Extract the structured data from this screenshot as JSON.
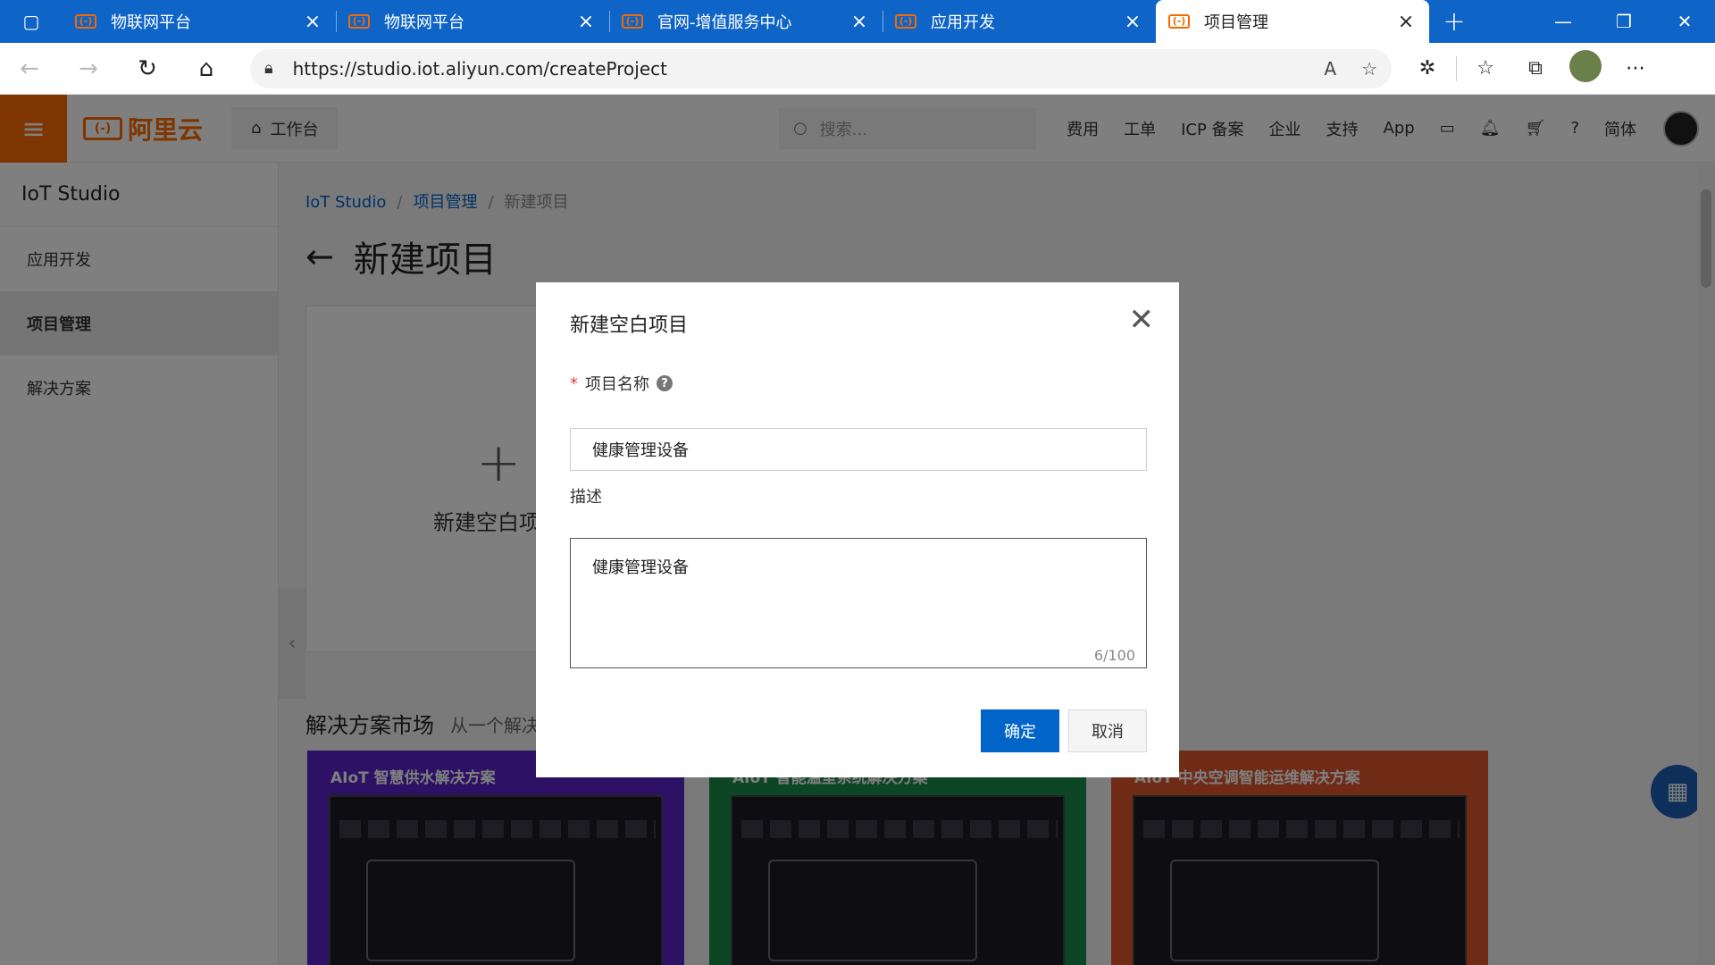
{
  "browser": {
    "tabs": [
      {
        "title": "物联网平台",
        "active": false
      },
      {
        "title": "物联网平台",
        "active": false
      },
      {
        "title": "官网-增值服务中心",
        "active": false
      },
      {
        "title": "应用开发",
        "active": false
      },
      {
        "title": "项目管理",
        "active": true
      }
    ],
    "favicon_glyph": "(-)",
    "url": "https://studio.iot.aliyun.com/createProject"
  },
  "topnav": {
    "brand": "阿里云",
    "workbench": "工作台",
    "search_placeholder": "搜索...",
    "links": [
      "费用",
      "工单",
      "ICP 备案",
      "企业",
      "支持",
      "App"
    ],
    "language": "简体"
  },
  "sidebar": {
    "title": "IoT Studio",
    "items": [
      {
        "label": "应用开发",
        "active": false
      },
      {
        "label": "项目管理",
        "active": true
      },
      {
        "label": "解决方案",
        "active": false
      }
    ]
  },
  "main": {
    "breadcrumb": [
      "IoT Studio",
      "项目管理",
      "新建项目"
    ],
    "page_title": "新建项目",
    "blank_card_label": "新建空白项",
    "market_title": "解决方案市场",
    "market_subtitle": "从一个解决",
    "solutions": [
      {
        "title": "AIoT 智慧供水解决方案",
        "color": "#5b23c9"
      },
      {
        "title": "AIoT 智能温室系统解决方案",
        "color": "#1a8c4a"
      },
      {
        "title": "AIoT 中央空调智能运维解决方案",
        "color": "#e0572c"
      }
    ]
  },
  "modal": {
    "title": "新建空白项目",
    "name_label": "项目名称",
    "name_required_mark": "*",
    "name_value": "健康管理设备",
    "desc_label": "描述",
    "desc_value": "健康管理设备",
    "counter": "6/100",
    "ok_label": "确定",
    "cancel_label": "取消"
  },
  "colors": {
    "primary": "#0064c8",
    "brand_orange": "#ff6a00",
    "tabbar": "#0f64c8"
  }
}
